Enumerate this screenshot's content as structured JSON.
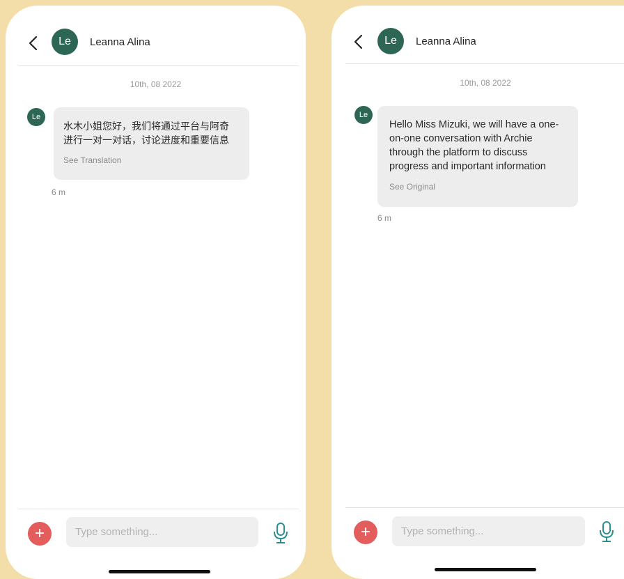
{
  "colors": {
    "page_background": "#f3dda8",
    "avatar": "#2e6656",
    "add_button": "#e35d5d",
    "mic_icon": "#2a8f8f",
    "bubble": "#ededed"
  },
  "left": {
    "header": {
      "avatar_initials": "Le",
      "contact_name": "Leanna Alina",
      "back_icon": "chevron-left-icon"
    },
    "date": "10th, 08 2022",
    "message": {
      "sender_initials": "Le",
      "line1": "水木小姐您好，我们将通过平台与阿奇",
      "line2": "进行一对一对话，讨论进度和重要信息",
      "action": "See Translation",
      "time": "6 m"
    },
    "composer": {
      "plus": "+",
      "placeholder": "Type something...",
      "mic_icon": "microphone-icon"
    }
  },
  "right": {
    "header": {
      "avatar_initials": "Le",
      "contact_name": "Leanna Alina",
      "back_icon": "chevron-left-icon"
    },
    "date": "10th, 08 2022",
    "message": {
      "sender_initials": "Le",
      "line1": "Hello Miss Mizuki, we will have a one-",
      "line2": "on-one conversation with Archie",
      "line3": "through the platform to discuss",
      "line4": "progress and important information",
      "action": "See Original",
      "time": "6 m"
    },
    "composer": {
      "plus": "+",
      "placeholder": "Type something...",
      "mic_icon": "microphone-icon"
    }
  }
}
